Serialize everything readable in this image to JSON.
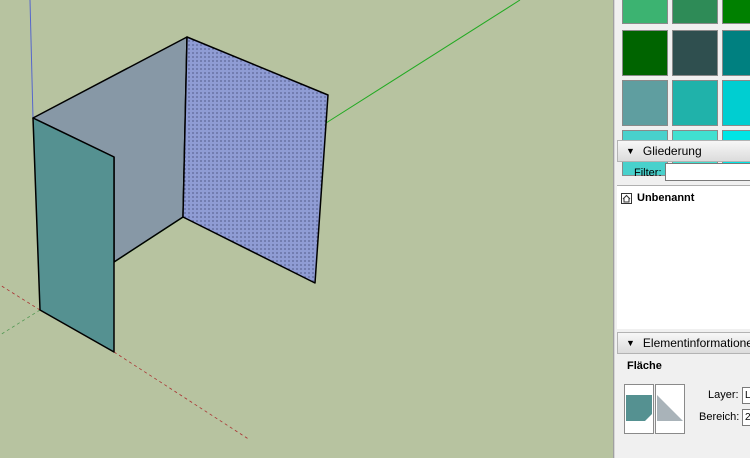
{
  "palette": {
    "colors": [
      "#3cb371",
      "#2e8b57",
      "#008000",
      "#006400",
      "#2f4f4f",
      "#008080",
      "#5f9ea0",
      "#20b2aa",
      "#00ced1",
      "#48d1cc",
      "#40e0d0",
      "#00e5e5"
    ]
  },
  "outliner": {
    "header": "Gliederung",
    "filter_label": "Filter:",
    "filter_value": "",
    "model_name": "Unbenannt"
  },
  "entity_info": {
    "header": "Elementinformationen",
    "type_label": "Fläche",
    "layer_label": "Layer:",
    "layer_value": "L",
    "area_label": "Bereich:",
    "area_value": "2"
  },
  "scene": {
    "background": "#b7c3a0",
    "wall_front_color": "#559191",
    "wall_back_color": "#8798a6",
    "wall_right_color": "#8f9cd4",
    "axis_red": "#cc2222",
    "axis_green": "#22aa22",
    "axis_blue": "#5566cc"
  }
}
